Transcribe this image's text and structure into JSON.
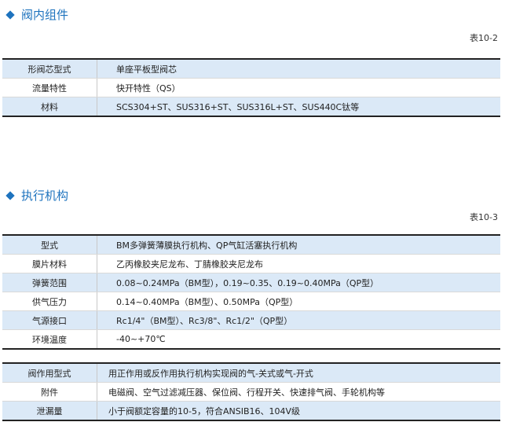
{
  "section1": {
    "title": "阀内组件",
    "table_label": "表10-2",
    "rows": [
      {
        "key": "形阀芯型式",
        "value": "单座平板型阀芯"
      },
      {
        "key": "流量特性",
        "value": "快开特性（QS）"
      },
      {
        "key": "材料",
        "value": "SCS304+ST、SUS316+ST、SUS316L+ST、SUS440C钛等"
      }
    ]
  },
  "section2": {
    "title": "执行机构",
    "table_label": "表10-3",
    "rows": [
      {
        "key": "型式",
        "value": "BM多弹簧薄膜执行机构、QP气缸活塞执行机构"
      },
      {
        "key": "膜片材料",
        "value": "乙丙橡胶夹尼龙布、丁腈橡胶夹尼龙布"
      },
      {
        "key": "弹簧范围",
        "value": "0.08~0.24MPa（BM型），0.19~0.35、0.19~0.40MPa（QP型）"
      },
      {
        "key": "供气压力",
        "value": "0.14~0.40MPa（BM型）、0.50MPa（QP型）"
      },
      {
        "key": "气源接口",
        "value": "Rc1/4\"（BM型）、Rc3/8\"、Rc1/2\"（QP型）"
      },
      {
        "key": "环境温度",
        "value": "-40~+70℃"
      }
    ],
    "rows2": [
      {
        "key": "阀作用型式",
        "value": "用正作用或反作用执行机构实现阀的气-关式或气-开式"
      },
      {
        "key": "附件",
        "value": "电磁阀、空气过滤减压器、保位阀、行程开关、快速排气阀、手轮机构等"
      },
      {
        "key": "泄漏量",
        "value": "小于阀额定容量的10-5，符合ANSIB16、104V级"
      }
    ]
  },
  "colors": {
    "accent": "#1e73be",
    "row_shade": "#dbe9f7"
  }
}
